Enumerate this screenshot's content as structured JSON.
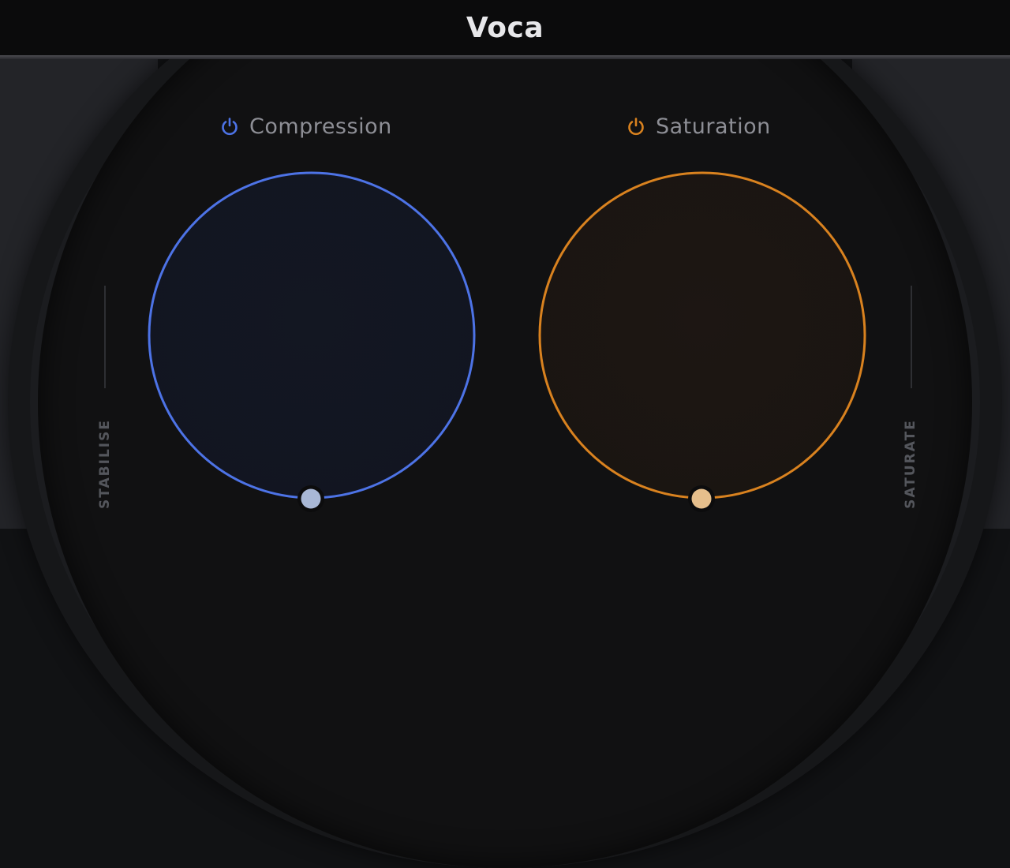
{
  "app": {
    "title": "Voca"
  },
  "modules": [
    {
      "id": "compression",
      "label": "Compression",
      "enabled": true,
      "accent": "#4d73e6",
      "handle_color": "#a9b8d6",
      "amount": 0
    },
    {
      "id": "saturation",
      "label": "Saturation",
      "enabled": true,
      "accent": "#d9821f",
      "handle_color": "#e6bf8c",
      "amount": 0
    }
  ],
  "side_labels": {
    "left": "STABILISE",
    "right": "SATURATE"
  },
  "icons": {
    "power": "power-icon"
  }
}
